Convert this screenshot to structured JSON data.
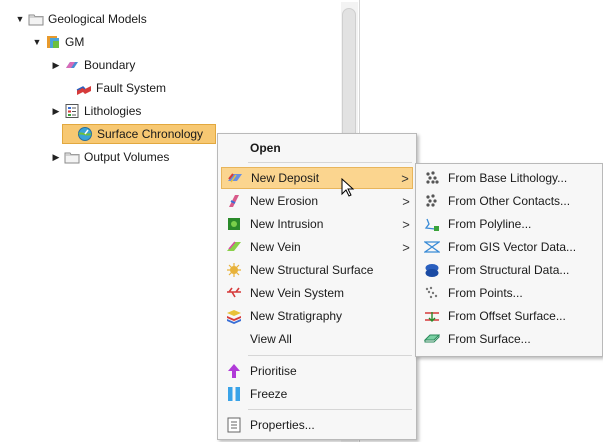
{
  "tree": {
    "items": [
      {
        "label": "Geological Models",
        "expander": "▼",
        "icon": "folder-icon"
      },
      {
        "label": "GM",
        "expander": "▼",
        "icon": "geomodel-icon"
      },
      {
        "label": "Boundary",
        "expander": "▶",
        "icon": "boundary-icon"
      },
      {
        "label": "Fault System",
        "expander": "",
        "icon": "fault-system-icon"
      },
      {
        "label": "Lithologies",
        "expander": "▶",
        "icon": "lithologies-icon"
      },
      {
        "label": "Surface Chronology",
        "expander": "",
        "icon": "surface-chronology-icon",
        "selected": true
      },
      {
        "label": "Output Volumes",
        "expander": "▶",
        "icon": "folder-icon"
      }
    ]
  },
  "context_menu": {
    "open": "Open",
    "items": [
      {
        "label": "New Deposit",
        "icon": "deposit-icon",
        "submenu": true,
        "highlighted": true
      },
      {
        "label": "New Erosion",
        "icon": "erosion-icon",
        "submenu": true
      },
      {
        "label": "New Intrusion",
        "icon": "intrusion-icon",
        "submenu": true
      },
      {
        "label": "New Vein",
        "icon": "vein-icon",
        "submenu": true
      },
      {
        "label": "New Structural Surface",
        "icon": "structural-surface-icon"
      },
      {
        "label": "New Vein System",
        "icon": "vein-system-icon"
      },
      {
        "label": "New Stratigraphy",
        "icon": "stratigraphy-icon"
      },
      {
        "label": "View All",
        "icon": ""
      }
    ],
    "prioritise": "Prioritise",
    "freeze": "Freeze",
    "properties": "Properties...",
    "arrow_glyph": ">"
  },
  "submenu": {
    "items": [
      {
        "label": "From Base Lithology...",
        "icon": "base-lithology-icon"
      },
      {
        "label": "From Other Contacts...",
        "icon": "other-contacts-icon"
      },
      {
        "label": "From Polyline...",
        "icon": "polyline-icon"
      },
      {
        "label": "From GIS Vector Data...",
        "icon": "gis-vector-icon"
      },
      {
        "label": "From Structural Data...",
        "icon": "structural-data-icon"
      },
      {
        "label": "From Points...",
        "icon": "points-icon"
      },
      {
        "label": "From Offset Surface...",
        "icon": "offset-surface-icon"
      },
      {
        "label": "From Surface...",
        "icon": "surface-icon"
      }
    ]
  },
  "colors": {
    "selection": "#f7c872",
    "menu_highlight": "#fbd58f",
    "menu_background": "#f7f7f7"
  }
}
